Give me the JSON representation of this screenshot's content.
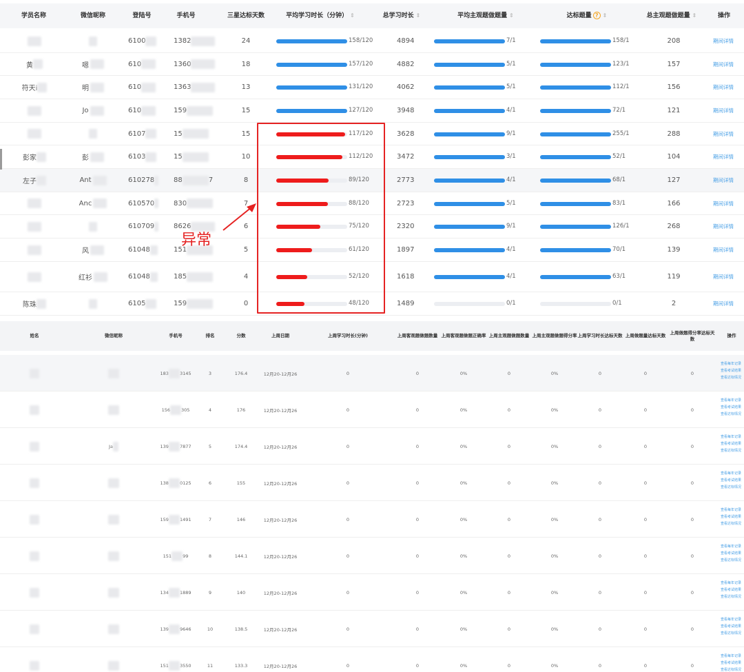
{
  "top_table": {
    "headers": {
      "name": "学员名称",
      "wechat": "微信昵称",
      "seat": "登陆号",
      "phone": "手机号",
      "three_star_days": "三星达标天数",
      "avg_study": "平均学习时长（分钟）",
      "total_study": "总学习时长",
      "avg_subjective": "平均主观题做题量",
      "standard_count": "达标题量",
      "total_subjective": "总主观题做题量",
      "action": "操作"
    },
    "sort_icon": "⇕",
    "help_icon": "?",
    "rows": [
      {
        "name": "",
        "wechat": "",
        "seat": "6100",
        "phone": "1382",
        "three_star": "24",
        "avg_study": "158/120",
        "avg_study_frac": 1.0,
        "total": "4894",
        "avg_subj": "7/1",
        "avg_subj_frac": 1.0,
        "standard": "158/1",
        "standard_frac": 1.0,
        "total_subj": "208",
        "action": "期间详情"
      },
      {
        "name": "黄",
        "wechat": "嗯",
        "seat": "610",
        "phone": "1360",
        "three_star": "18",
        "avg_study": "157/120",
        "avg_study_frac": 1.0,
        "total": "4882",
        "avg_subj": "5/1",
        "avg_subj_frac": 1.0,
        "standard": "123/1",
        "standard_frac": 1.0,
        "total_subj": "157",
        "action": "期间详情"
      },
      {
        "name": "符天i",
        "wechat": "明",
        "seat": "610",
        "phone": "1363",
        "three_star": "13",
        "avg_study": "131/120",
        "avg_study_frac": 1.0,
        "total": "4062",
        "avg_subj": "5/1",
        "avg_subj_frac": 1.0,
        "standard": "112/1",
        "standard_frac": 1.0,
        "total_subj": "156",
        "action": "期间详情"
      },
      {
        "name": "",
        "wechat": "Jo",
        "seat": "610",
        "phone": "159",
        "three_star": "15",
        "avg_study": "127/120",
        "avg_study_frac": 1.0,
        "total": "3948",
        "avg_subj": "4/1",
        "avg_subj_frac": 1.0,
        "standard": "72/1",
        "standard_frac": 1.0,
        "total_subj": "121",
        "action": "期间详情"
      },
      {
        "name": "",
        "wechat": "",
        "seat": "6107",
        "phone": "15",
        "three_star": "15",
        "avg_study": "117/120",
        "avg_study_frac": 0.975,
        "total": "3628",
        "avg_subj": "9/1",
        "avg_subj_frac": 1.0,
        "standard": "255/1",
        "standard_frac": 1.0,
        "total_subj": "288",
        "action": "期间详情"
      },
      {
        "name": "彭家",
        "wechat": "彭",
        "seat": "6103",
        "phone": "15",
        "three_star": "10",
        "avg_study": "112/120",
        "avg_study_frac": 0.933,
        "total": "3472",
        "avg_subj": "3/1",
        "avg_subj_frac": 1.0,
        "standard": "52/1",
        "standard_frac": 1.0,
        "total_subj": "104",
        "action": "期间详情"
      },
      {
        "name": "左子",
        "wechat": "Ant",
        "seat": "610278",
        "phone": "88",
        "phone_tail": "7",
        "three_star": "8",
        "avg_study": "89/120",
        "avg_study_frac": 0.742,
        "total": "2773",
        "avg_subj": "4/1",
        "avg_subj_frac": 1.0,
        "standard": "68/1",
        "standard_frac": 1.0,
        "total_subj": "127",
        "action": "期间详情"
      },
      {
        "name": "",
        "wechat": "Anc",
        "seat": "610570",
        "phone": "830",
        "three_star": "7",
        "avg_study": "88/120",
        "avg_study_frac": 0.733,
        "total": "2723",
        "avg_subj": "5/1",
        "avg_subj_frac": 1.0,
        "standard": "83/1",
        "standard_frac": 1.0,
        "total_subj": "166",
        "action": "期间详情"
      },
      {
        "name": "",
        "wechat": "",
        "seat": "610709",
        "phone": "8626",
        "three_star": "6",
        "avg_study": "75/120",
        "avg_study_frac": 0.625,
        "total": "2320",
        "avg_subj": "9/1",
        "avg_subj_frac": 1.0,
        "standard": "126/1",
        "standard_frac": 1.0,
        "total_subj": "268",
        "action": "期间详情"
      },
      {
        "name": "",
        "wechat": "风",
        "seat": "61048",
        "phone": "151",
        "three_star": "5",
        "avg_study": "61/120",
        "avg_study_frac": 0.508,
        "total": "1897",
        "avg_subj": "4/1",
        "avg_subj_frac": 1.0,
        "standard": "70/1",
        "standard_frac": 1.0,
        "total_subj": "139",
        "action": "期间详情"
      },
      {
        "name": "",
        "wechat": "红衫",
        "seat": "61048",
        "phone": "185",
        "three_star": "4",
        "avg_study": "52/120",
        "avg_study_frac": 0.433,
        "total": "1618",
        "avg_subj": "4/1",
        "avg_subj_frac": 1.0,
        "standard": "63/1",
        "standard_frac": 1.0,
        "total_subj": "119",
        "action": "期间详情"
      },
      {
        "name": "陈珠",
        "wechat": "",
        "seat": "6105",
        "phone": "159",
        "three_star": "0",
        "avg_study": "48/120",
        "avg_study_frac": 0.4,
        "total": "1489",
        "avg_subj": "0/1",
        "avg_subj_frac": 0.0,
        "standard": "0/1",
        "standard_frac": 0.0,
        "total_subj": "2",
        "action": "期间详情"
      }
    ]
  },
  "annotation": {
    "label": "异常"
  },
  "bottom_table": {
    "headers": [
      "姓名",
      "微信昵称",
      "手机号",
      "排名",
      "分数",
      "上周日期",
      "上周学习时长(分钟)",
      "上周客观题做题数量",
      "上周客观题做题正确率",
      "上周主观题做题数量",
      "上周主观题做题得分率",
      "上周学习时长达标天数",
      "上周做题量达标天数",
      "上周做题得分率达标天数",
      "操作"
    ],
    "ops": [
      "查看每年记录",
      "查看考试结果",
      "查看达标情况"
    ],
    "rows": [
      {
        "phone_a": "183",
        "phone_b": "3145",
        "rank": "3",
        "score": "176.4",
        "date": "12月20-12月26",
        "study": "0",
        "obj_count": "0",
        "obj_rate": "0%",
        "subj_count": "0",
        "subj_rate": "0%",
        "days_study": "0",
        "days_count": "0",
        "days_rate": "0"
      },
      {
        "phone_a": "156",
        "phone_b": "305",
        "rank": "4",
        "score": "176",
        "date": "12月20-12月26",
        "study": "0",
        "obj_count": "0",
        "obj_rate": "0%",
        "subj_count": "0",
        "subj_rate": "0%",
        "days_study": "0",
        "days_count": "0",
        "days_rate": "0"
      },
      {
        "wechat": "Ja",
        "phone_a": "139",
        "phone_b": "7877",
        "rank": "5",
        "score": "174.4",
        "date": "12月20-12月26",
        "study": "0",
        "obj_count": "0",
        "obj_rate": "0%",
        "subj_count": "0",
        "subj_rate": "0%",
        "days_study": "0",
        "days_count": "0",
        "days_rate": "0"
      },
      {
        "phone_a": "138",
        "phone_b": "0125",
        "rank": "6",
        "score": "155",
        "date": "12月20-12月26",
        "study": "0",
        "obj_count": "0",
        "obj_rate": "0%",
        "subj_count": "0",
        "subj_rate": "0%",
        "days_study": "0",
        "days_count": "0",
        "days_rate": "0"
      },
      {
        "phone_a": "159",
        "phone_b": "1491",
        "rank": "7",
        "score": "146",
        "date": "12月20-12月26",
        "study": "0",
        "obj_count": "0",
        "obj_rate": "0%",
        "subj_count": "0",
        "subj_rate": "0%",
        "days_study": "0",
        "days_count": "0",
        "days_rate": "0"
      },
      {
        "phone_a": "151",
        "phone_b": "99",
        "rank": "8",
        "score": "144.1",
        "date": "12月20-12月26",
        "study": "0",
        "obj_count": "0",
        "obj_rate": "0%",
        "subj_count": "0",
        "subj_rate": "0%",
        "days_study": "0",
        "days_count": "0",
        "days_rate": "0"
      },
      {
        "phone_a": "134",
        "phone_b": "1889",
        "rank": "9",
        "score": "140",
        "date": "12月20-12月26",
        "study": "0",
        "obj_count": "0",
        "obj_rate": "0%",
        "subj_count": "0",
        "subj_rate": "0%",
        "days_study": "0",
        "days_count": "0",
        "days_rate": "0"
      },
      {
        "phone_a": "139",
        "phone_b": "9646",
        "rank": "10",
        "score": "138.5",
        "date": "12月20-12月26",
        "study": "0",
        "obj_count": "0",
        "obj_rate": "0%",
        "subj_count": "0",
        "subj_rate": "0%",
        "days_study": "0",
        "days_count": "0",
        "days_rate": "0"
      },
      {
        "phone_a": "151",
        "phone_b": "3550",
        "rank": "11",
        "score": "133.3",
        "date": "12月20-12月26",
        "study": "0",
        "obj_count": "0",
        "obj_rate": "0%",
        "subj_count": "0",
        "subj_rate": "0%",
        "days_study": "0",
        "days_count": "0",
        "days_rate": "0"
      }
    ]
  },
  "colors": {
    "bar_blue": "#2f8fe6",
    "bar_red": "#ee1c1c",
    "link": "#4aa0e6",
    "annotation": "#e52222"
  }
}
